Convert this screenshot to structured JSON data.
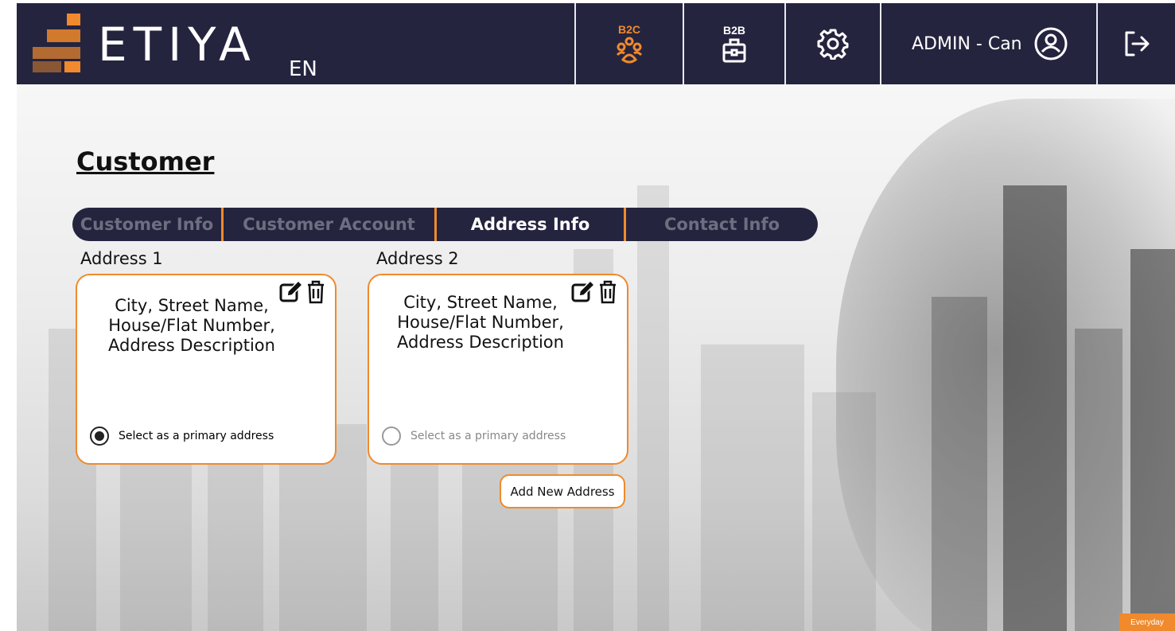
{
  "header": {
    "brand": "ETIYA",
    "language": "EN",
    "b2c_label": "B2C",
    "b2b_label": "B2B",
    "user": "ADMIN - Can"
  },
  "page": {
    "title": "Customer"
  },
  "tabs": [
    {
      "label": "Customer Info",
      "active": false
    },
    {
      "label": "Customer Account",
      "active": false
    },
    {
      "label": "Address Info",
      "active": true
    },
    {
      "label": "Contact Info",
      "active": false
    }
  ],
  "addresses": [
    {
      "label": "Address 1",
      "text": "City, Street Name, House/Flat Number, Address Description",
      "primary_label": "Select as a primary address",
      "primary": true
    },
    {
      "label": "Address 2",
      "text": "City, Street Name, House/Flat Number, Address Description",
      "primary_label": "Select as a primary address",
      "primary": false
    }
  ],
  "add_button": "Add New Address",
  "corner_badge": "Everyday",
  "colors": {
    "header_bg": "#25243f",
    "accent": "#f08a2c"
  }
}
